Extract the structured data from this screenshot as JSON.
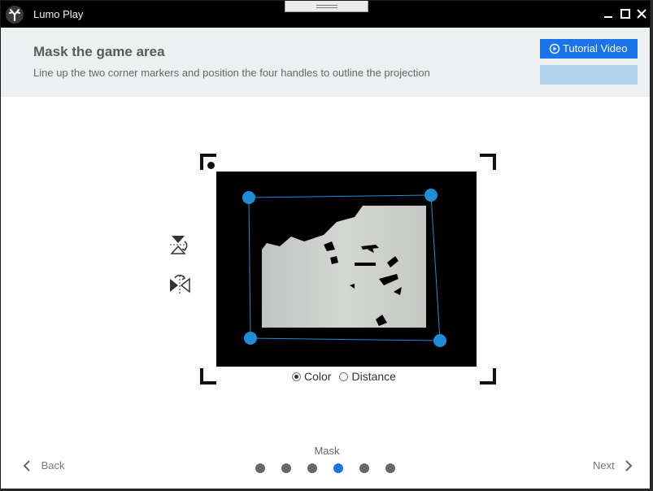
{
  "titlebar": {
    "title": "Lumo Play",
    "logo_icon": "antler-logo-icon"
  },
  "banner": {
    "title": "Mask the game area",
    "subtitle": "Line up the two corner markers and position the four handles to outline the projection",
    "tutorial_label": "Tutorial Video",
    "tutorial_icon": "play-circle-icon"
  },
  "tools": [
    {
      "name": "flip-vertical-icon"
    },
    {
      "name": "flip-horizontal-icon"
    }
  ],
  "mode": {
    "options": [
      "Color",
      "Distance"
    ],
    "selected": "Color"
  },
  "wizard": {
    "step_label": "Mask",
    "total_steps": 6,
    "current_step": 4,
    "back_label": "Back",
    "next_label": "Next"
  },
  "colors": {
    "accent": "#1a73e8",
    "handle": "#1e8fd6",
    "banner_bg": "#ecf0f1",
    "titlebar_bg": "#000000"
  }
}
